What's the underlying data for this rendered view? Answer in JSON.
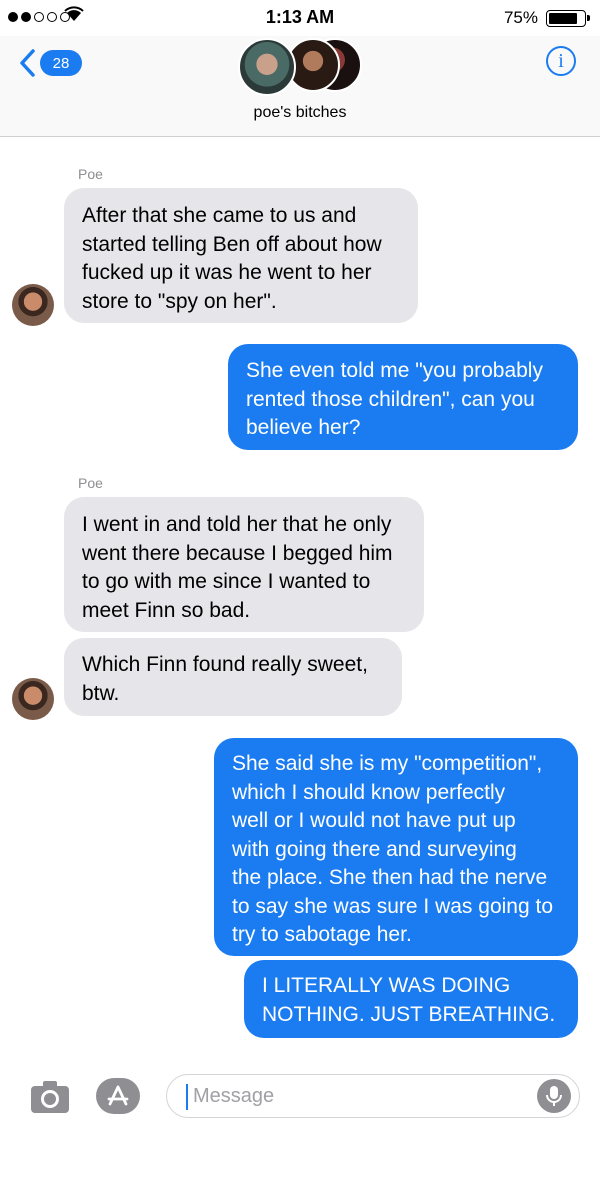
{
  "status_bar": {
    "time": "1:13 AM",
    "battery": "75%"
  },
  "header": {
    "back_count": "28",
    "group_name": "poe's bitches",
    "info_label": "i"
  },
  "messages": [
    {
      "sender": "Poe",
      "text": "After that she came to us and\nstarted telling Ben off about how\nfucked up it was he went to her\nstore to \"spy on her\"."
    },
    {
      "text": "She even told me \"you probably\nrented those children\", can you\nbelieve her?"
    },
    {
      "sender": "Poe",
      "text": "I went in and told her that he only\nwent there because I begged him\nto go with me since I wanted to\nmeet Finn so bad."
    },
    {
      "text": "Which Finn found really sweet,\nbtw."
    },
    {
      "text": "She said she is my \"competition\",\nwhich I should know perfectly\nwell or I would not have put up\nwith going there and surveying\nthe place. She then had the nerve\nto say she was sure I was going to\ntry to sabotage her."
    },
    {
      "text": "I LITERALLY WAS DOING\nNOTHING. JUST BREATHING."
    }
  ],
  "input": {
    "placeholder": "Message"
  },
  "colors": {
    "accent": "#1a7cf0",
    "incoming_bubble": "#e5e5ea"
  },
  "icons": [
    "wifi-icon",
    "back-chevron-icon",
    "info-icon",
    "camera-icon",
    "app-store-icon",
    "microphone-icon"
  ]
}
